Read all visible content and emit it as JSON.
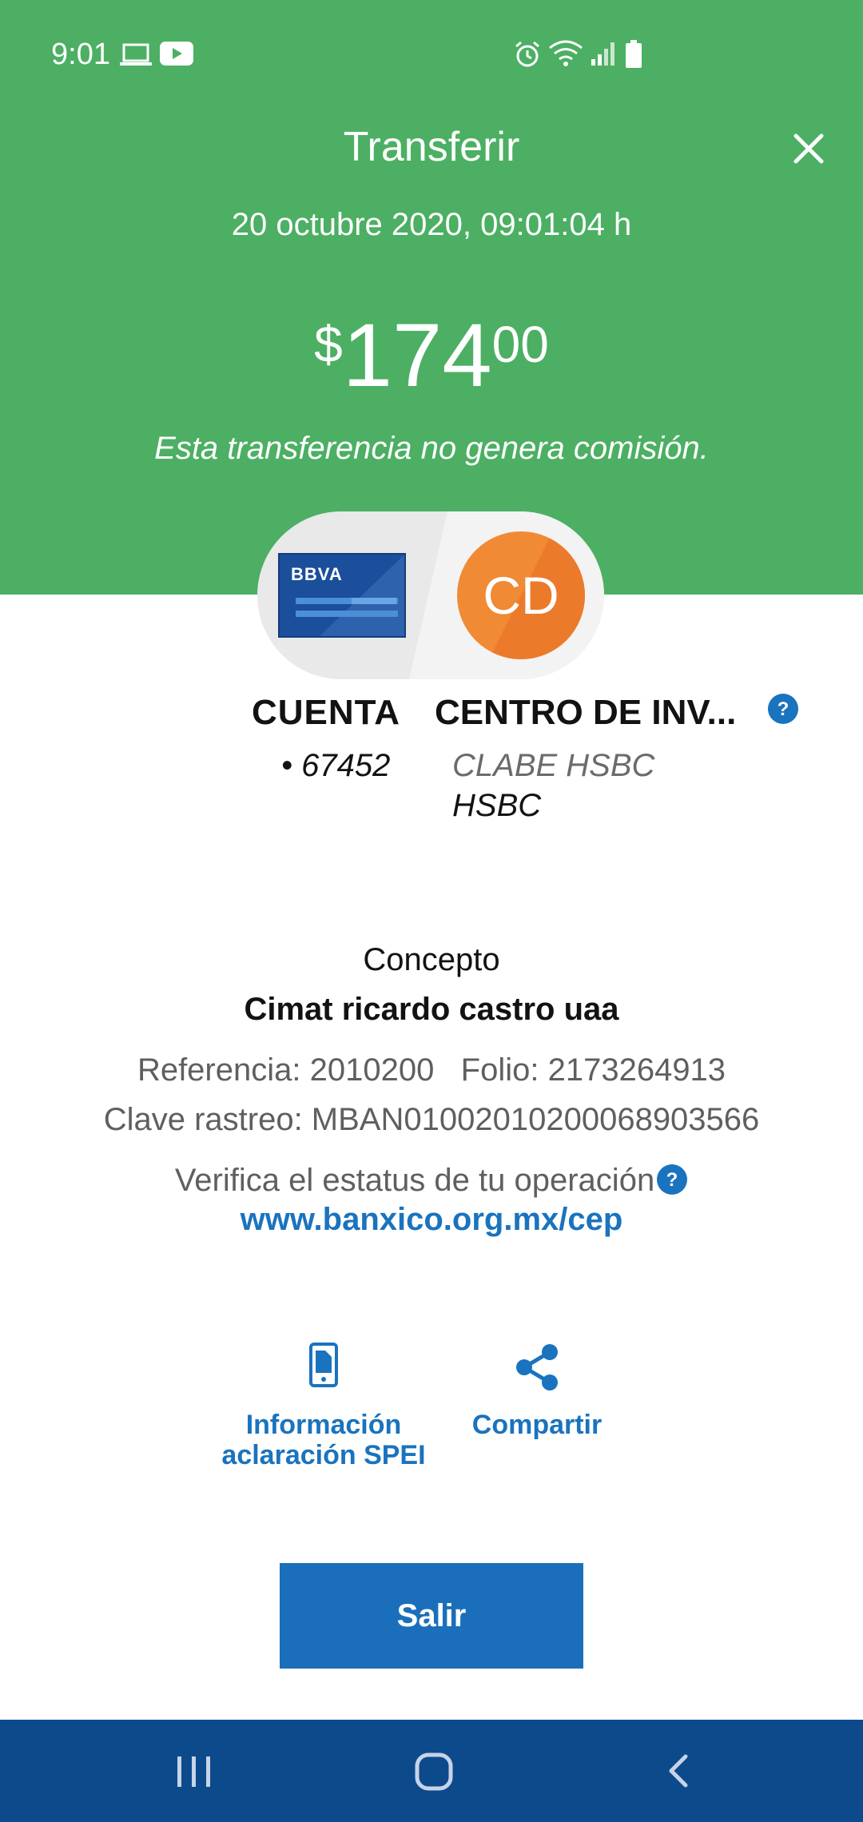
{
  "status_bar": {
    "time": "9:01",
    "left_icons": [
      "laptop-icon",
      "youtube-icon"
    ],
    "right_icons": [
      "alarm-icon",
      "wifi-icon",
      "signal-icon",
      "battery-icon"
    ]
  },
  "header": {
    "title": "Transferir",
    "close_icon": "close-icon",
    "datetime": "20 octubre 2020, 09:01:04 h",
    "amount": {
      "currency": "$",
      "integer": "174",
      "cents": "00"
    },
    "commission_note": "Esta transferencia no genera comisión."
  },
  "accounts": {
    "from": {
      "card_brand": "BBVA",
      "name": "CUENTA",
      "number": "• 67452"
    },
    "to": {
      "avatar_initials": "CD",
      "name": "CENTRO DE INV...",
      "clabe": "CLABE HSBC",
      "bank": "HSBC"
    }
  },
  "details": {
    "concept_label": "Concepto",
    "concept_value": "Cimat ricardo castro uaa",
    "reference_line": "Referencia: 2010200   Folio: 2173264913",
    "clave_rastreo": "Clave rastreo: MBAN01002010200068903566",
    "verify_text": "Verifica el estatus de tu operación",
    "verify_link": "www.banxico.org.mx/cep"
  },
  "actions": {
    "spei_info_line1": "Información",
    "spei_info_line2": "aclaración SPEI",
    "share": "Compartir"
  },
  "exit_button": "Salir",
  "nav_bar": [
    "recents-icon",
    "home-icon",
    "back-icon"
  ],
  "colors": {
    "header_green": "#4caf63",
    "accent_blue": "#1a73be",
    "button_blue": "#1b6fba",
    "nav_blue": "#0d4a8c",
    "avatar_orange": "#f08a34"
  }
}
